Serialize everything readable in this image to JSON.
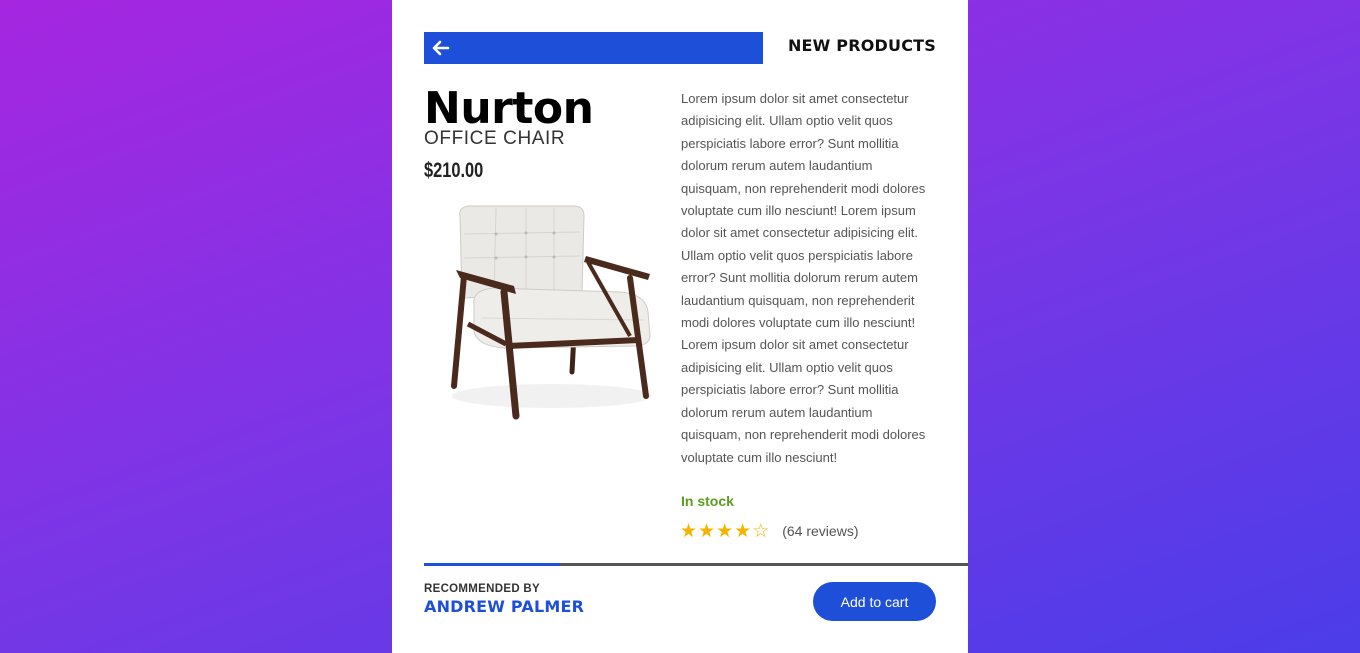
{
  "header": {
    "back_icon": "arrow-left-icon",
    "section_title": "NEW PRODUCTS"
  },
  "product": {
    "name": "Nurton",
    "type": "OFFICE CHAIR",
    "price": "$210.00",
    "image_icon": "armchair-image",
    "description": "Lorem ipsum dolor sit amet consectetur adipisicing elit. Ullam optio velit quos perspiciatis labore error? Sunt mollitia dolorum rerum autem laudantium quisquam, non reprehenderit modi dolores voluptate cum illo nesciunt! Lorem ipsum dolor sit amet consectetur adipisicing elit. Ullam optio velit quos perspiciatis labore error? Sunt mollitia dolorum rerum autem laudantium quisquam, non reprehenderit modi dolores voluptate cum illo nesciunt! Lorem ipsum dolor sit amet consectetur adipisicing elit. Ullam optio velit quos perspiciatis labore error? Sunt mollitia dolorum rerum autem laudantium quisquam, non reprehenderit modi dolores voluptate cum illo nesciunt!",
    "stock_status": "In stock",
    "rating": 4,
    "rating_max": 5,
    "reviews": "(64 reviews)"
  },
  "footer": {
    "recommended_label": "RECOMMENDED BY",
    "recommended_name": "ANDREW PALMER",
    "cart_button": "Add to cart"
  },
  "colors": {
    "accent": "#1e4fd8",
    "stock": "#5a9e1f",
    "star": "#f5b400"
  }
}
